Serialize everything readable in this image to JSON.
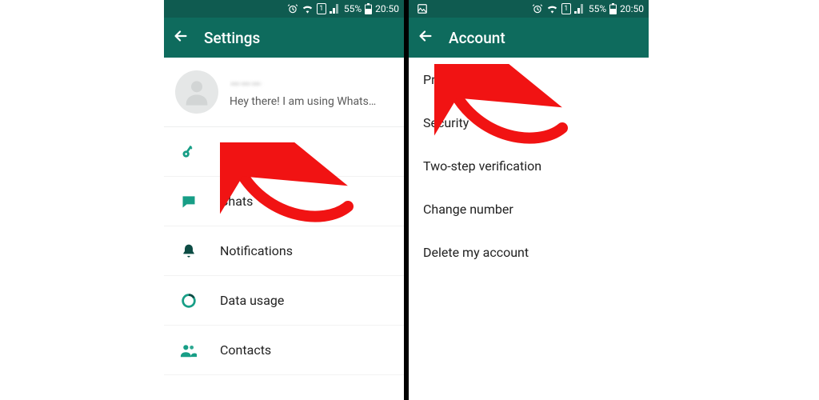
{
  "status": {
    "battery_pct": "55%",
    "time": "20:50",
    "sim": "1"
  },
  "left": {
    "title": "Settings",
    "profile": {
      "name": "———",
      "status": "Hey there! I am using Whats…"
    },
    "items": [
      {
        "label": "Account"
      },
      {
        "label": "Chats"
      },
      {
        "label": "Notifications"
      },
      {
        "label": "Data usage"
      },
      {
        "label": "Contacts"
      }
    ]
  },
  "right": {
    "title": "Account",
    "items": [
      {
        "label": "Privacy"
      },
      {
        "label": "Security"
      },
      {
        "label": "Two-step verification"
      },
      {
        "label": "Change number"
      },
      {
        "label": "Delete my account"
      }
    ]
  },
  "colors": {
    "brand_dark": "#0f5b50",
    "brand": "#0e6b5d",
    "accent": "#179e86",
    "arrow": "#f11313"
  }
}
